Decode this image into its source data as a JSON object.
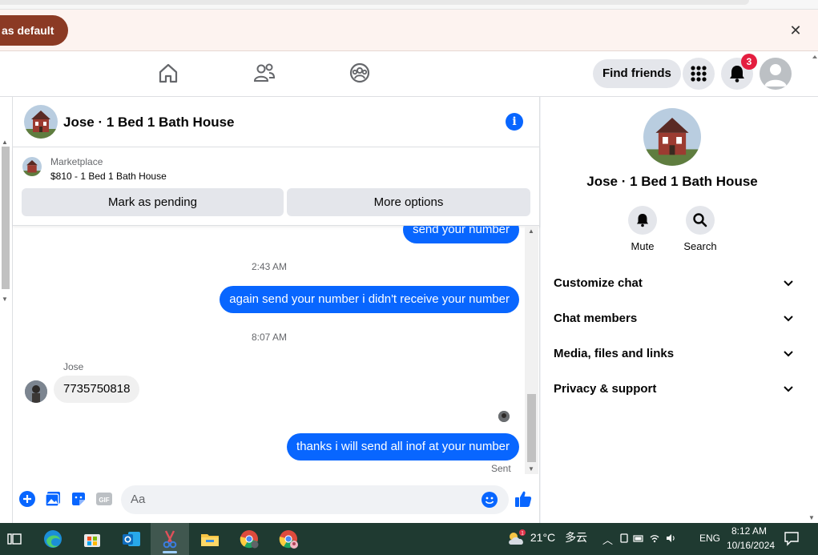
{
  "infobar": {
    "default_button": "as default",
    "close_glyph": "✕"
  },
  "nav": {
    "icons": [
      "home-icon",
      "friends-icon",
      "groups-icon"
    ],
    "find_friends": "Find friends",
    "notification_count": "3"
  },
  "chat": {
    "title": "Jose · 1 Bed 1 Bath House",
    "info_glyph": "i",
    "marketplace": {
      "label": "Marketplace",
      "item": "$810 - 1 Bed 1 Bath House",
      "mark_pending": "Mark as pending",
      "more_options": "More options"
    },
    "messages": [
      {
        "type": "out",
        "text": "send your number"
      },
      {
        "type": "time",
        "text": "2:43 AM"
      },
      {
        "type": "out",
        "text": "again send your number i didn't receive your number"
      },
      {
        "type": "time",
        "text": "8:07 AM"
      },
      {
        "type": "sender",
        "text": "Jose"
      },
      {
        "type": "in",
        "text": "7735750818"
      },
      {
        "type": "out",
        "text": "thanks i will send all inof at your number"
      },
      {
        "type": "status",
        "text": "Sent"
      }
    ],
    "composer_placeholder": "Aa"
  },
  "details": {
    "title": "Jose · 1 Bed 1 Bath House",
    "actions": [
      {
        "label": "Mute",
        "icon": "bell-icon"
      },
      {
        "label": "Search",
        "icon": "search-icon"
      }
    ],
    "sections": [
      "Customize chat",
      "Chat members",
      "Media, files and links",
      "Privacy & support"
    ]
  },
  "taskbar": {
    "temperature": "21°C",
    "condition": "多云",
    "weather_badge": "1",
    "language": "ENG",
    "time": "8:12 AM",
    "date": "10/16/2024"
  },
  "colors": {
    "messenger_blue": "#0866ff",
    "badge_red": "#e41e3f",
    "default_btn": "#8b3a24",
    "taskbar": "#1f3a31"
  }
}
